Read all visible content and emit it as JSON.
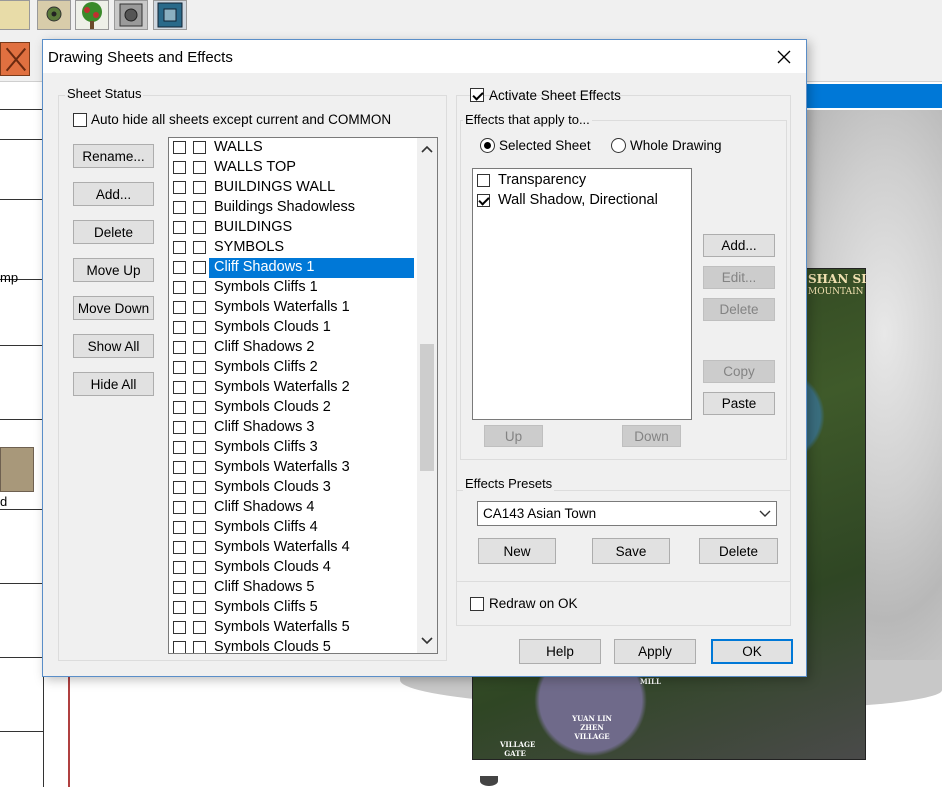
{
  "background_app": {
    "toolbar_icons": [
      "scroll-icon",
      "gear-box-icon",
      "tree-icon",
      "vault-icon",
      "frame-icon"
    ],
    "side_labels": [
      "mp",
      "d"
    ],
    "map": {
      "title": "SHAN SI",
      "subtitle": "MOUNTAIN",
      "labels": [
        "MILL",
        "YUAN LIN ZHEN VILLAGE",
        "VILLAGE GATE"
      ]
    }
  },
  "dialog": {
    "title": "Drawing Sheets and Effects",
    "sheet_status": {
      "legend": "Sheet Status",
      "auto_hide_label": "Auto hide all sheets except current and COMMON",
      "auto_hide_checked": false,
      "buttons": [
        "Rename...",
        "Add...",
        "Delete",
        "Move Up",
        "Move Down",
        "Show All",
        "Hide All"
      ],
      "sheets": [
        {
          "name": "WALLS",
          "selected": false
        },
        {
          "name": "WALLS TOP",
          "selected": false
        },
        {
          "name": "BUILDINGS WALL",
          "selected": false
        },
        {
          "name": "Buildings Shadowless",
          "selected": false
        },
        {
          "name": "BUILDINGS",
          "selected": false
        },
        {
          "name": "SYMBOLS",
          "selected": false
        },
        {
          "name": "Cliff Shadows 1",
          "selected": true
        },
        {
          "name": "Symbols Cliffs 1",
          "selected": false
        },
        {
          "name": "Symbols Waterfalls 1",
          "selected": false
        },
        {
          "name": "Symbols Clouds 1",
          "selected": false
        },
        {
          "name": "Cliff Shadows 2",
          "selected": false
        },
        {
          "name": "Symbols Cliffs 2",
          "selected": false
        },
        {
          "name": "Symbols Waterfalls 2",
          "selected": false
        },
        {
          "name": "Symbols Clouds 2",
          "selected": false
        },
        {
          "name": "Cliff Shadows 3",
          "selected": false
        },
        {
          "name": "Symbols Cliffs 3",
          "selected": false
        },
        {
          "name": "Symbols Waterfalls 3",
          "selected": false
        },
        {
          "name": "Symbols Clouds 3",
          "selected": false
        },
        {
          "name": "Cliff Shadows 4",
          "selected": false
        },
        {
          "name": "Symbols Cliffs 4",
          "selected": false
        },
        {
          "name": "Symbols Waterfalls 4",
          "selected": false
        },
        {
          "name": "Symbols Clouds 4",
          "selected": false
        },
        {
          "name": "Cliff Shadows 5",
          "selected": false
        },
        {
          "name": "Symbols Cliffs 5",
          "selected": false
        },
        {
          "name": "Symbols Waterfalls 5",
          "selected": false
        },
        {
          "name": "Symbols Clouds 5",
          "selected": false
        }
      ]
    },
    "effects": {
      "activate_label": "Activate Sheet Effects",
      "activate_checked": true,
      "apply_legend": "Effects that apply to...",
      "radio_selected_sheet": "Selected Sheet",
      "radio_whole_drawing": "Whole Drawing",
      "selected_scope": "Selected Sheet",
      "items": [
        {
          "name": "Transparency",
          "checked": false
        },
        {
          "name": "Wall Shadow, Directional",
          "checked": true
        }
      ],
      "buttons": {
        "add": "Add...",
        "edit": "Edit...",
        "delete": "Delete",
        "copy": "Copy",
        "paste": "Paste",
        "up": "Up",
        "down": "Down"
      }
    },
    "presets": {
      "legend": "Effects Presets",
      "selected": "CA143 Asian Town",
      "new": "New",
      "save": "Save",
      "delete": "Delete"
    },
    "redraw_label": "Redraw on OK",
    "redraw_checked": false,
    "footer": {
      "help": "Help",
      "apply": "Apply",
      "ok": "OK"
    }
  }
}
